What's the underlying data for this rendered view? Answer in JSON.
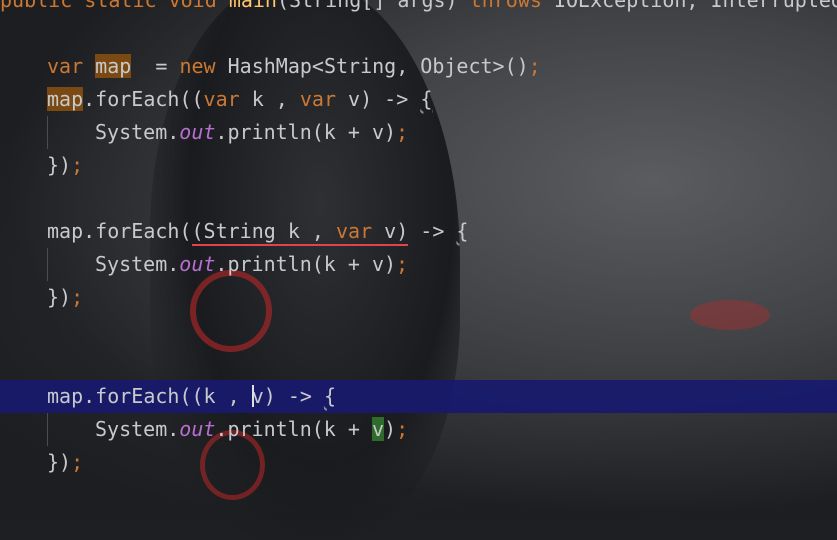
{
  "header": {
    "text_public": "public",
    "text_static": "static",
    "text_void": "void",
    "text_main": "main",
    "text_params": "(String[] args)",
    "text_throws": "throws",
    "text_exceptions": "IOException, InterruptedE"
  },
  "code": {
    "line1": {
      "kw_var": "var",
      "ident": "map",
      "rest": "  = new HashMap<String, Object>()",
      "kw_new": "new",
      "semi": ";"
    },
    "line2": {
      "ident": "map",
      "mid1": ".forEach((",
      "kw_var1": "var",
      "mid2": " k , ",
      "kw_var2": "var",
      "mid3": " v) -> ",
      "brace": "{"
    },
    "line3": {
      "system": "System.",
      "out": "out",
      "call": ".println(k + v)",
      "semi": ";"
    },
    "line4": {
      "close": "})",
      "semi": ";"
    },
    "line6": {
      "prefix": "map.forEach(",
      "err_part1": "(String k , ",
      "kw_var": "var",
      "err_part2": " v)",
      "arrow": " -> ",
      "brace": "{"
    },
    "line7": {
      "system": "System.",
      "out": "out",
      "call": ".println(k + v)",
      "semi": ";"
    },
    "line8": {
      "close": "})",
      "semi": ";"
    },
    "line10": {
      "prefix": "map.forEach((k , ",
      "v": "v",
      "suffix": ") -> ",
      "brace": "{"
    },
    "line11": {
      "system": "System.",
      "out": "out",
      "call_a": ".println(k + ",
      "v": "v",
      "call_b": ")",
      "semi": ";"
    },
    "line12": {
      "close": "})",
      "semi": ";"
    }
  },
  "colors": {
    "keyword": "#cc7832",
    "static_field": "#b86fd0",
    "text": "#c7c9cc",
    "current_line": "#18186e",
    "error_underline": "#e2434b"
  }
}
